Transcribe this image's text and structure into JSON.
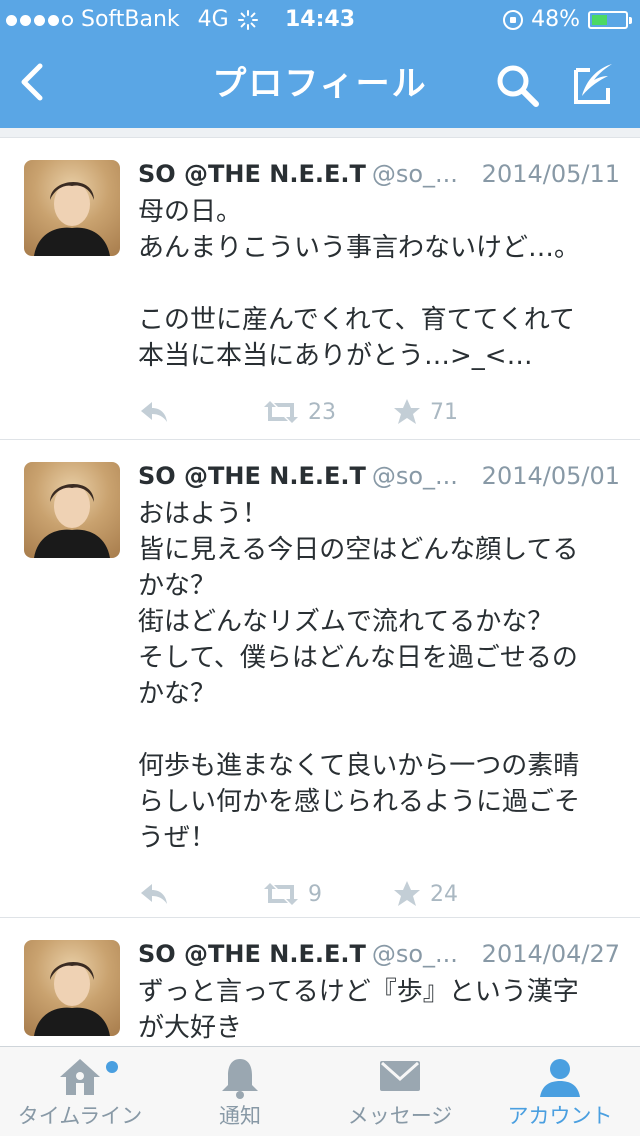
{
  "status_bar": {
    "carrier": "SoftBank",
    "network": "4G",
    "time": "14:43",
    "battery_text": "48%",
    "battery_level": 0.48,
    "signal_bars": 4
  },
  "nav": {
    "title": "プロフィール"
  },
  "tweets": [
    {
      "name": "SO @THE N.E.E.T",
      "handle": "@so_...",
      "date": "2014/05/11",
      "text": "母の日。\nあんまりこういう事言わないけど…。\n\nこの世に産んでくれて、育ててくれて\n本当に本当にありがとう…>_<…",
      "retweets": "23",
      "favorites": "71"
    },
    {
      "name": "SO @THE N.E.E.T",
      "handle": "@so_...",
      "date": "2014/05/01",
      "text": "おはよう！\n皆に見える今日の空はどんな顔してる\nかな？\n街はどんなリズムで流れてるかな？\nそして、僕らはどんな日を過ごせるの\nかな？\n\n何歩も進まなくて良いから一つの素晴\nらしい何かを感じられるように過ごそ\nうぜ！",
      "retweets": "9",
      "favorites": "24"
    },
    {
      "name": "SO @THE N.E.E.T",
      "handle": "@so_...",
      "date": "2014/04/27",
      "text": "ずっと言ってるけど『歩』という漢字\nが大好き",
      "retweets": "",
      "favorites": ""
    }
  ],
  "tabs": [
    {
      "label": "タイムライン",
      "icon": "home-icon",
      "active": false,
      "badge": true
    },
    {
      "label": "通知",
      "icon": "bell-icon",
      "active": false,
      "badge": false
    },
    {
      "label": "メッセージ",
      "icon": "envelope-icon",
      "active": false,
      "badge": false
    },
    {
      "label": "アカウント",
      "icon": "person-icon",
      "active": true,
      "badge": false
    }
  ],
  "colors": {
    "header_blue": "#5aa6e5",
    "accent_blue": "#4a9fe0",
    "muted_gray": "#8899a6",
    "battery_green": "#4cd964"
  }
}
